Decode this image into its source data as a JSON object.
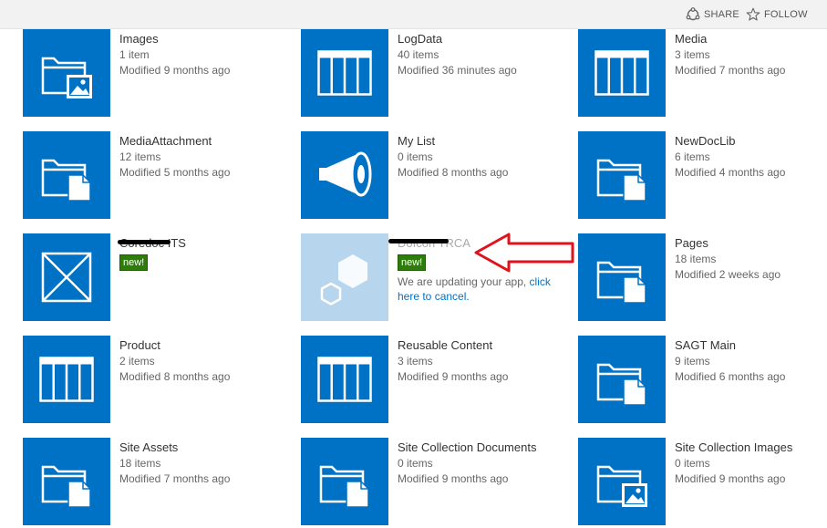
{
  "topbar": {
    "share_label": "SHARE",
    "follow_label": "FOLLOW"
  },
  "colors": {
    "tile_blue": "#0072c6",
    "tile_pending": "#b7d6ee",
    "badge_green": "#2e7d0a",
    "link_blue": "#0072c6",
    "arrow_red": "#e0121b"
  },
  "tiles": [
    {
      "title": "Images",
      "count": "1 item",
      "modified": "Modified 9 months ago",
      "icon": "picture-library-icon"
    },
    {
      "title": "LogData",
      "count": "40 items",
      "modified": "Modified 36 minutes ago",
      "icon": "list-icon"
    },
    {
      "title": "Media",
      "count": "3 items",
      "modified": "Modified 7 months ago",
      "icon": "list-icon"
    },
    {
      "title": "MediaAttachment",
      "count": "12 items",
      "modified": "Modified 5 months ago",
      "icon": "document-library-icon"
    },
    {
      "title": "My List",
      "count": "0 items",
      "modified": "Modified 8 months ago",
      "icon": "announcements-icon"
    },
    {
      "title": "NewDocLib",
      "count": "6 items",
      "modified": "Modified 4 months ago",
      "icon": "document-library-icon"
    },
    {
      "title": "Coredoc ITS",
      "badge": "new!",
      "icon": "app-placeholder-icon"
    },
    {
      "title": "DoIcon TRCA",
      "badge": "new!",
      "update_text": "We are updating your app, ",
      "update_link": "click here to cancel.",
      "icon": "app-updating-icon"
    },
    {
      "title": "Pages",
      "count": "18 items",
      "modified": "Modified 2 weeks ago",
      "icon": "document-library-icon"
    },
    {
      "title": "Product",
      "count": "2 items",
      "modified": "Modified 8 months ago",
      "icon": "list-icon"
    },
    {
      "title": "Reusable Content",
      "count": "3 items",
      "modified": "Modified 9 months ago",
      "icon": "list-icon"
    },
    {
      "title": "SAGT Main",
      "count": "9 items",
      "modified": "Modified 6 months ago",
      "icon": "document-library-icon"
    },
    {
      "title": "Site Assets",
      "count": "18 items",
      "modified": "Modified 7 months ago",
      "icon": "document-library-icon"
    },
    {
      "title": "Site Collection Documents",
      "count": "0 items",
      "modified": "Modified 9 months ago",
      "icon": "document-library-icon"
    },
    {
      "title": "Site Collection Images",
      "count": "0 items",
      "modified": "Modified 9 months ago",
      "icon": "picture-library-icon"
    }
  ]
}
